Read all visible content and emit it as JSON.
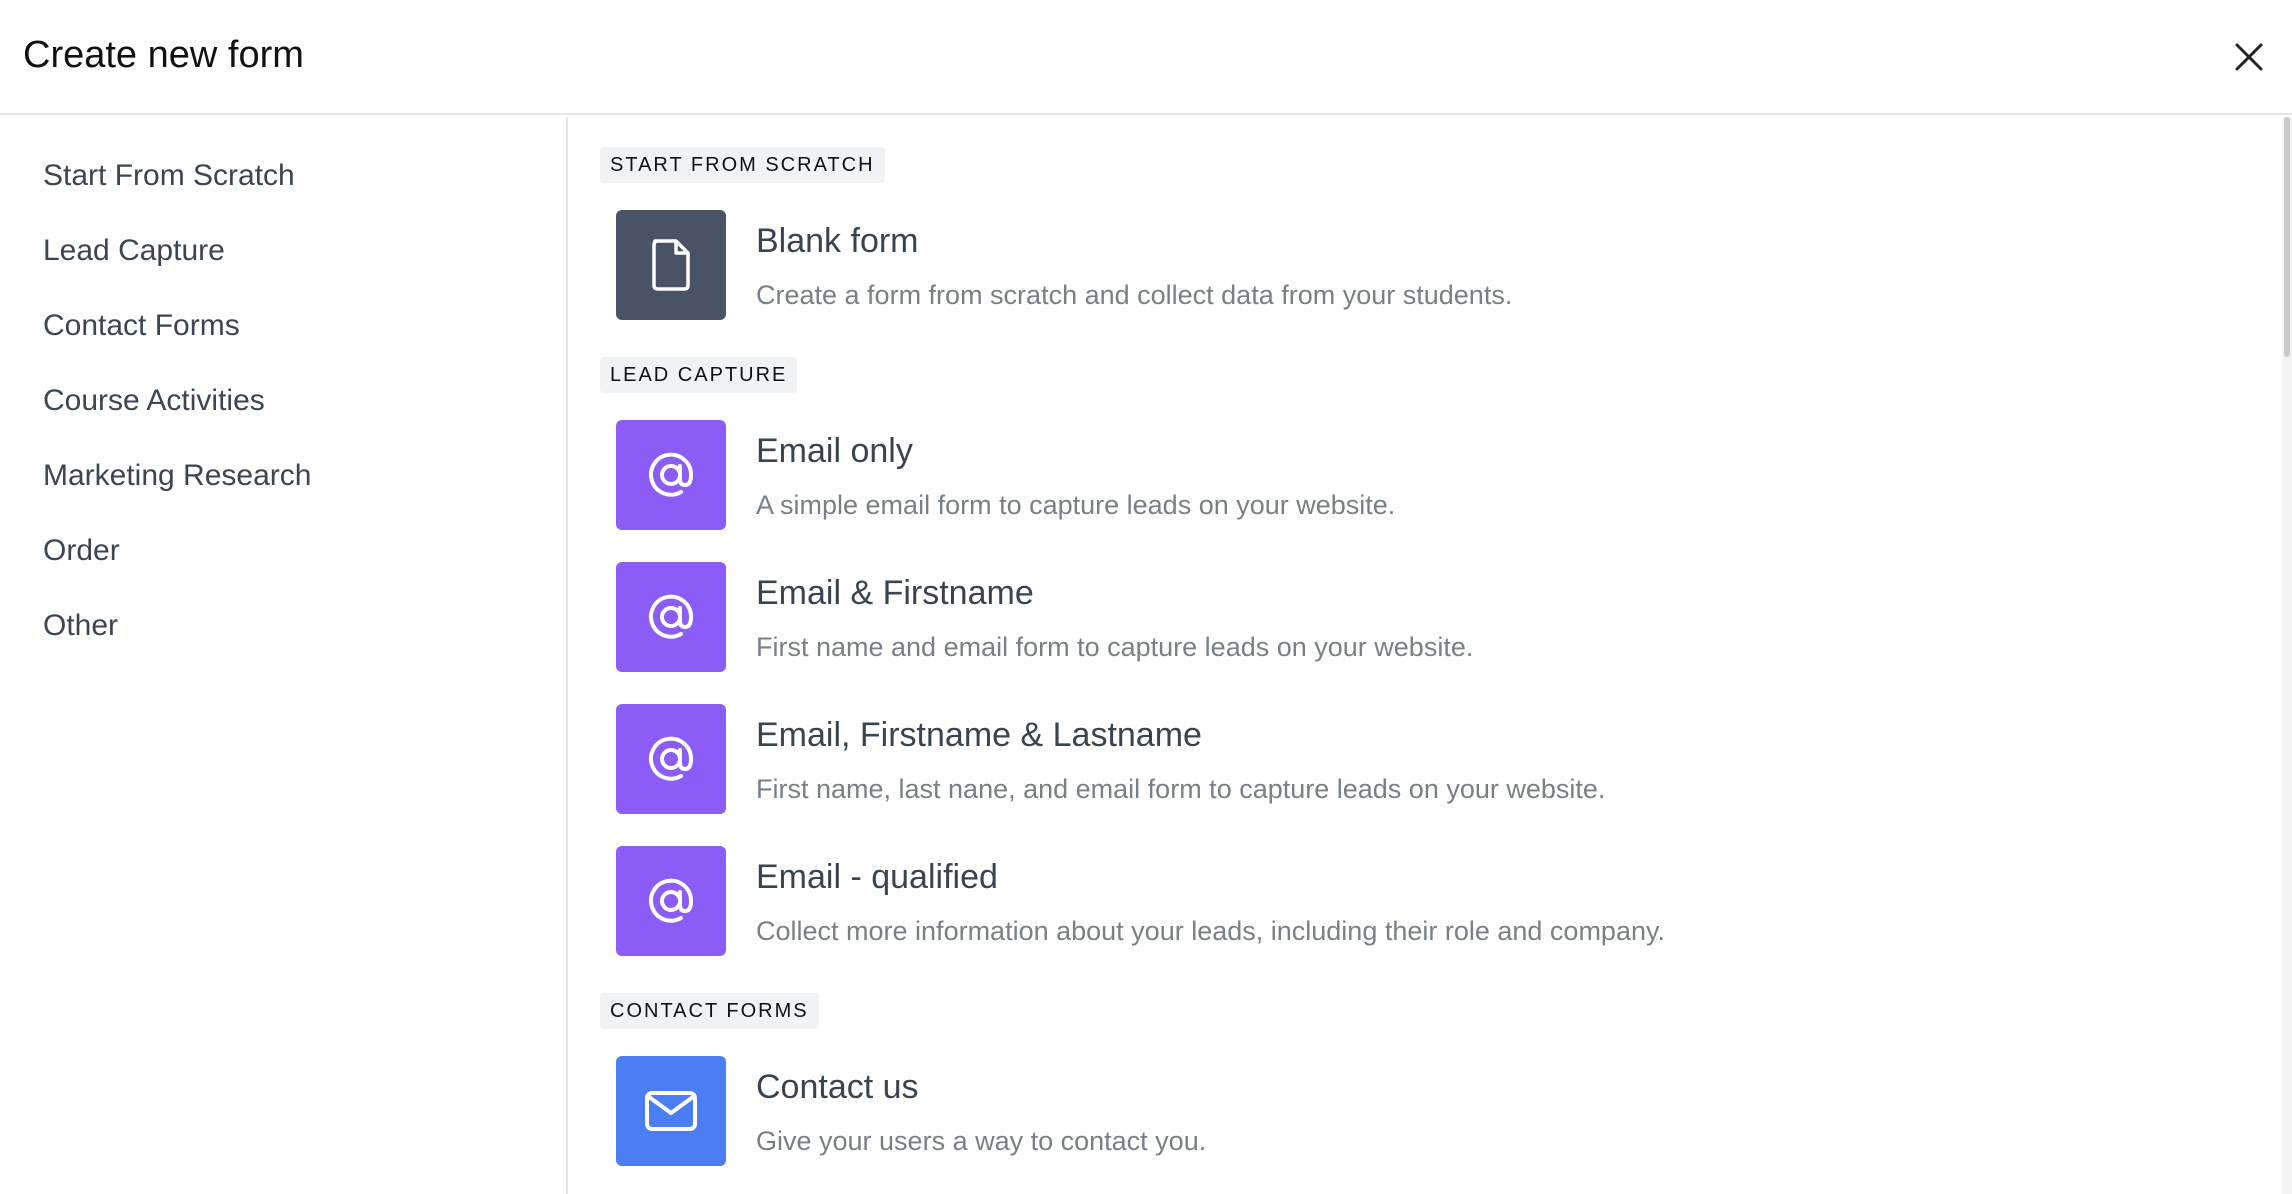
{
  "dialog": {
    "title": "Create new form",
    "close_icon": "close-icon"
  },
  "sidebar": {
    "items": [
      {
        "label": "Start From Scratch"
      },
      {
        "label": "Lead Capture"
      },
      {
        "label": "Contact Forms"
      },
      {
        "label": "Course Activities"
      },
      {
        "label": "Marketing Research"
      },
      {
        "label": "Order"
      },
      {
        "label": "Other"
      }
    ]
  },
  "sections": [
    {
      "tag": "START FROM SCRATCH",
      "cards": [
        {
          "title": "Blank form",
          "desc": "Create a form from scratch and collect data from your students.",
          "icon": "document-icon",
          "color": "#4a5365"
        }
      ]
    },
    {
      "tag": "LEAD CAPTURE",
      "cards": [
        {
          "title": "Email only",
          "desc": "A simple email form to capture leads on your website.",
          "icon": "at-sign-icon",
          "color": "#8b5cf6"
        },
        {
          "title": "Email & Firstname",
          "desc": "First name and email form to capture leads on your website.",
          "icon": "at-sign-icon",
          "color": "#8b5cf6"
        },
        {
          "title": "Email, Firstname & Lastname",
          "desc": "First name, last nane, and email form to capture leads on your website.",
          "icon": "at-sign-icon",
          "color": "#8b5cf6"
        },
        {
          "title": "Email - qualified",
          "desc": "Collect more information about your leads, including their role and company.",
          "icon": "at-sign-icon",
          "color": "#8b5cf6"
        }
      ]
    },
    {
      "tag": "CONTACT FORMS",
      "cards": [
        {
          "title": "Contact us",
          "desc": "Give your users a way to contact you.",
          "icon": "envelope-icon",
          "color": "#4c7ef3"
        }
      ]
    }
  ]
}
